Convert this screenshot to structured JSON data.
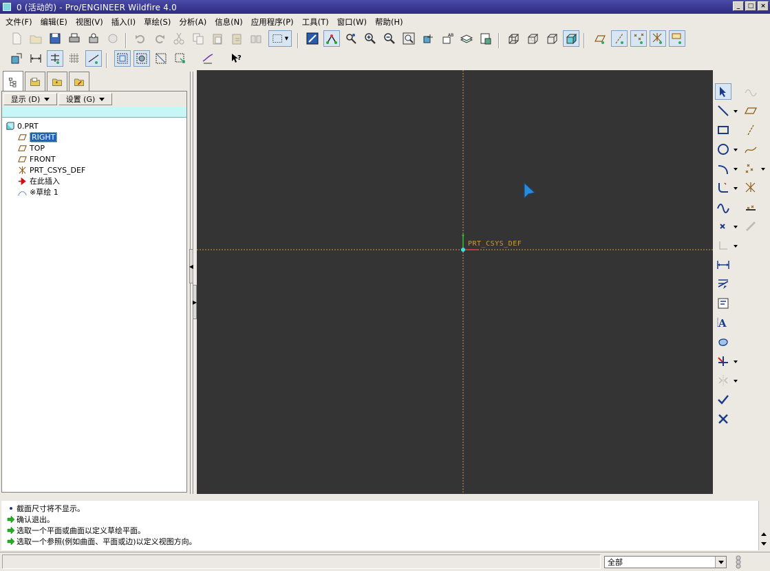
{
  "window": {
    "title": "0 (活动的) - Pro/ENGINEER Wildfire 4.0",
    "controls": {
      "minimize": "_",
      "maximize": "□",
      "close": "×"
    }
  },
  "menubar": {
    "items": [
      "文件(F)",
      "编辑(E)",
      "视图(V)",
      "插入(I)",
      "草绘(S)",
      "分析(A)",
      "信息(N)",
      "应用程序(P)",
      "工具(T)",
      "窗口(W)",
      "帮助(H)"
    ]
  },
  "toolbar": {
    "row1": [
      "new-icon",
      "open-icon",
      "save-icon",
      "print-icon",
      "send-icon",
      "rename-icon",
      "undo-icon",
      "redo-icon",
      "cut-icon",
      "copy-icon",
      "paste-icon",
      "paste-special-icon",
      "regenerate-icon",
      "select-box-icon",
      "sketch-view-icon",
      "sketch-display-icon",
      "repaint-icon",
      "zoom-in-icon",
      "zoom-out-icon",
      "refit-icon",
      "orient-icon",
      "saved-views-icon",
      "layers-icon",
      "view-manager-icon",
      "wireframe-icon",
      "hidden-line-icon",
      "no-hidden-icon",
      "shading-icon",
      "datum-plane-display-icon",
      "datum-axis-display-icon",
      "datum-point-display-icon",
      "csys-display-icon",
      "annotation-display-icon"
    ],
    "row2": [
      "sketch-setup-icon",
      "dimension-display-icon",
      "constraint-display-icon",
      "grid-display-icon",
      "vertex-display-icon",
      "overlap-icon",
      "shade-closed-icon",
      "open-ends-icon",
      "intent-manager-icon",
      "sketcher-palette-icon",
      "whats-this-icon"
    ]
  },
  "left_panel": {
    "tabs": [
      "model-tree-icon",
      "folder-browser-icon",
      "favorites-icon",
      "connections-icon"
    ],
    "buttons": {
      "show": "显示 (D)",
      "settings": "设置 (G)"
    },
    "tree": [
      {
        "label": "0.PRT",
        "icon": "part-icon",
        "indent": 0
      },
      {
        "label": "RIGHT",
        "icon": "datum-plane-icon",
        "indent": 1,
        "selected": true
      },
      {
        "label": "TOP",
        "icon": "datum-plane-icon",
        "indent": 1
      },
      {
        "label": "FRONT",
        "icon": "datum-plane-icon",
        "indent": 1
      },
      {
        "label": "PRT_CSYS_DEF",
        "icon": "csys-icon",
        "indent": 1
      },
      {
        "label": "在此插入",
        "icon": "insert-here-icon",
        "indent": 1
      },
      {
        "label": "※草绘 1",
        "icon": "sketch-icon",
        "indent": 1
      }
    ]
  },
  "canvas": {
    "background": "#343434",
    "datum_color": "#d49a3a",
    "csys_label": "PRT_CSYS_DEF"
  },
  "sketch_toolbar": {
    "col1": [
      "select-arrow-icon",
      "line-icon",
      "rectangle-icon",
      "circle-icon",
      "arc-icon",
      "fillet-icon",
      "spline-icon",
      "point-icon",
      "coordinate-system-icon",
      "dimension-icon",
      "modify-icon",
      "constraints-icon",
      "text-icon",
      "palette-icon",
      "trim-icon",
      "mirror-icon",
      "done-check-icon",
      "quit-x-icon"
    ],
    "col2": [
      "offset-icon",
      "plane-icon",
      "axis-icon",
      "curve-icon",
      "datum-point-icon",
      "datum-csys-icon",
      "analysis-icon",
      "link-icon"
    ]
  },
  "messages": [
    {
      "icon": "info-dot-icon",
      "text": "截面尺寸将不显示。"
    },
    {
      "icon": "prompt-arrow-icon",
      "text": "确认退出。"
    },
    {
      "icon": "prompt-arrow-icon",
      "text": "选取一个平面或曲面以定义草绘平面。"
    },
    {
      "icon": "prompt-arrow-icon",
      "text": "选取一个参照(例如曲面、平面或边)以定义视图方向。"
    }
  ],
  "status": {
    "filter_value": "全部"
  }
}
